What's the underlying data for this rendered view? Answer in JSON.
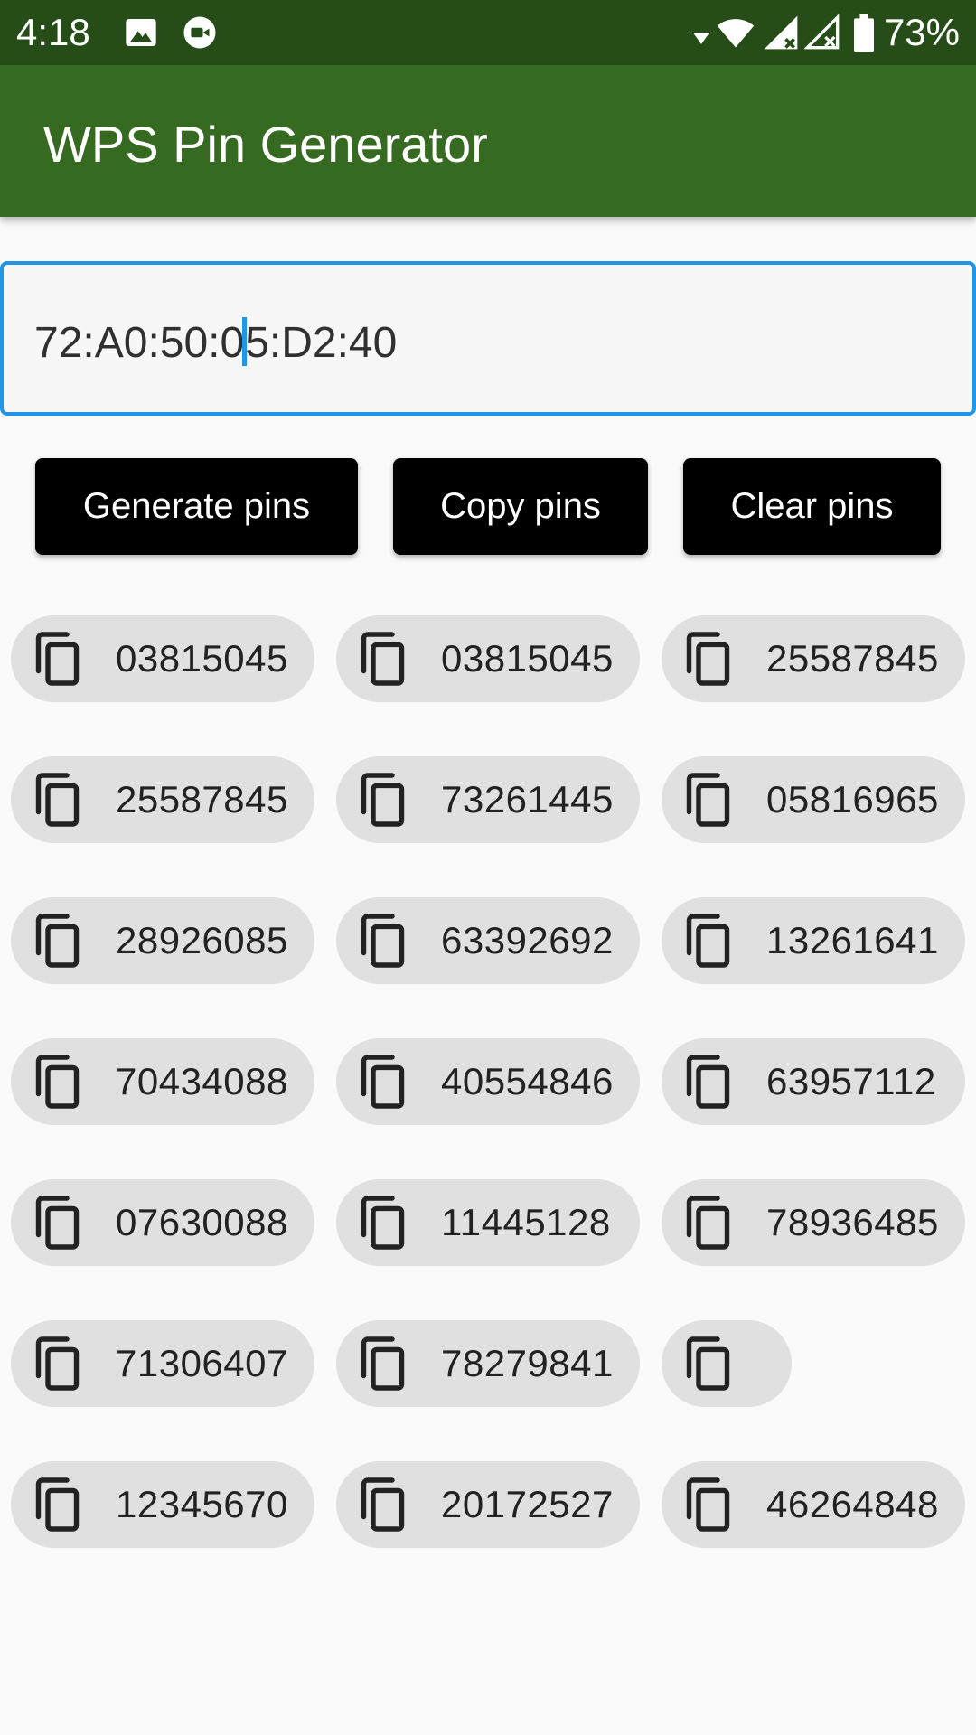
{
  "status_bar": {
    "time": "4:18",
    "battery": "73%",
    "icons": [
      "image-icon",
      "video-call-icon",
      "wifi-icon",
      "signal-icon",
      "signal-no-data-icon",
      "battery-icon"
    ]
  },
  "app_bar": {
    "title": "WPS Pin Generator",
    "color": "#356a20"
  },
  "mac_input": {
    "value_before_caret": "72:A0:50:0",
    "value_after_caret": "5:D2:40",
    "accent": "#2196e9"
  },
  "buttons": {
    "generate": "Generate pins",
    "copy": "Copy pins",
    "clear": "Clear pins"
  },
  "pins": [
    "03815045",
    "03815045",
    "25587845",
    "25587845",
    "73261445",
    "05816965",
    "28926085",
    "63392692",
    "13261641",
    "70434088",
    "40554846",
    "63957112",
    "07630088",
    "11445128",
    "78936485",
    "71306407",
    "78279841",
    "",
    "12345670",
    "20172527",
    "46264848"
  ]
}
